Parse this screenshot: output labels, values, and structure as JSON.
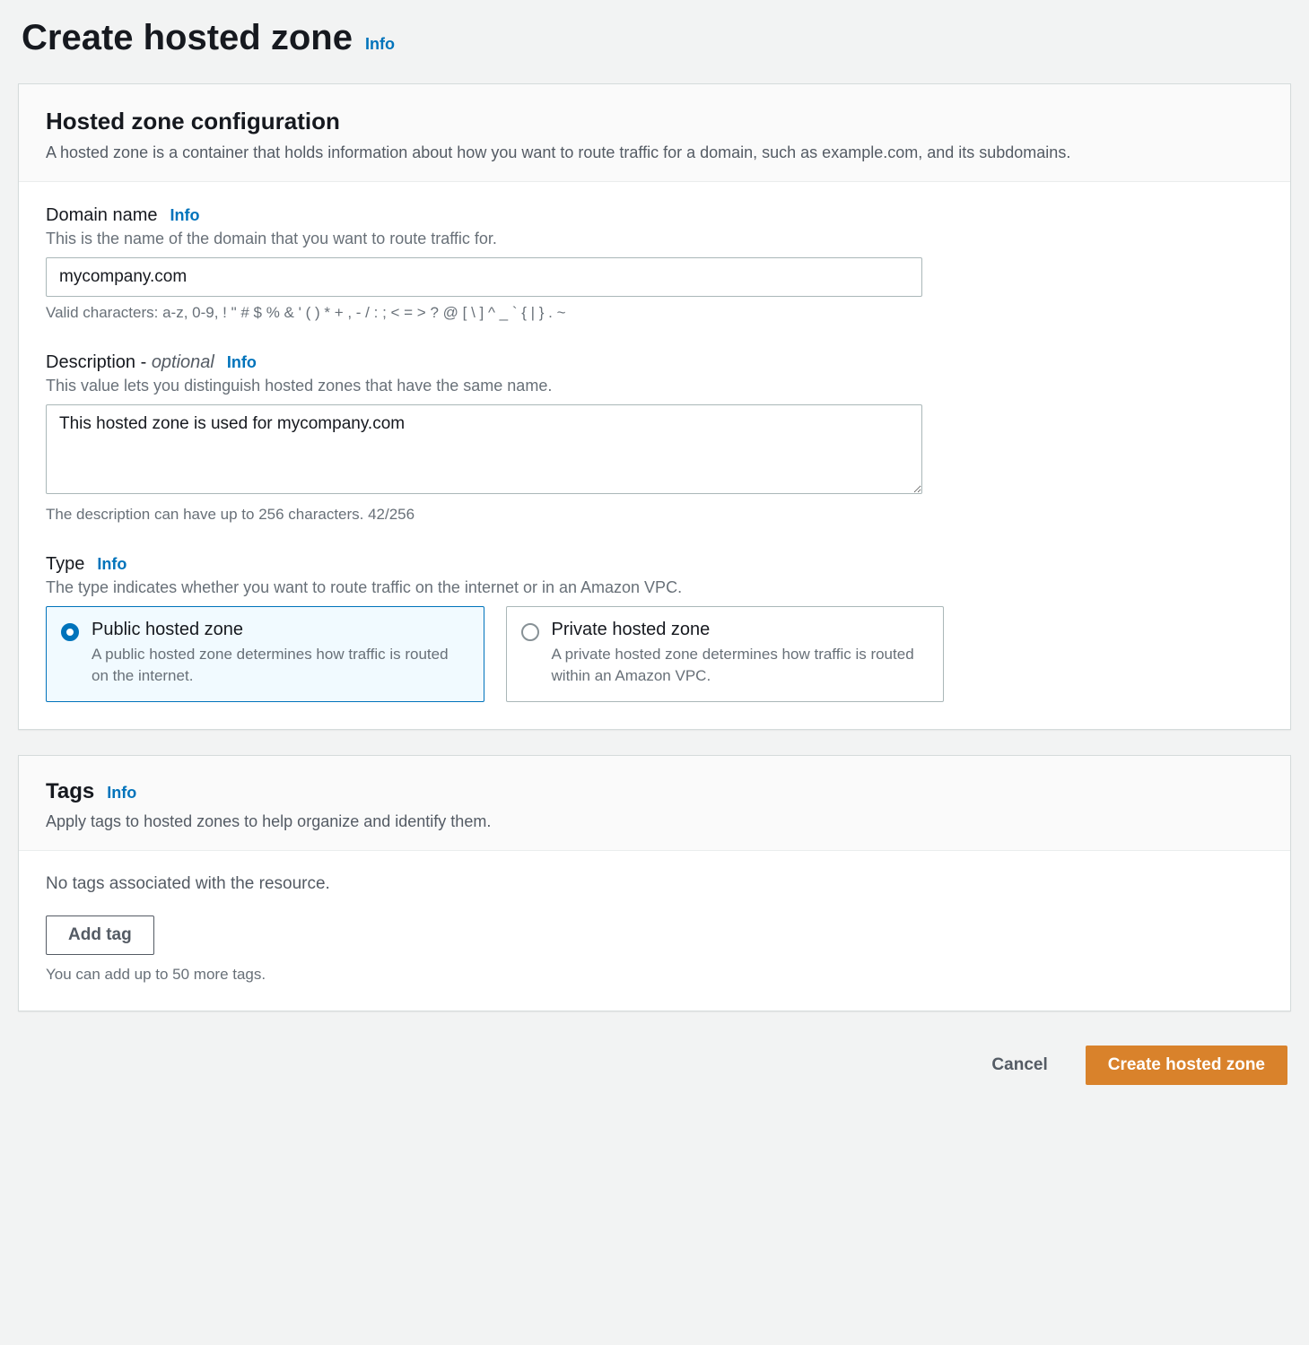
{
  "page": {
    "title": "Create hosted zone",
    "info": "Info"
  },
  "config_panel": {
    "title": "Hosted zone configuration",
    "subtitle": "A hosted zone is a container that holds information about how you want to route traffic for a domain, such as example.com, and its subdomains.",
    "domain": {
      "label": "Domain name",
      "info": "Info",
      "desc": "This is the name of the domain that you want to route traffic for.",
      "value": "mycompany.com",
      "hint": "Valid characters: a-z, 0-9, ! \" # $ % & ' ( ) * + , - / : ; < = > ? @ [ \\ ] ^ _ ` { | } . ~"
    },
    "description": {
      "label": "Description - ",
      "optional": "optional",
      "info": "Info",
      "desc": "This value lets you distinguish hosted zones that have the same name.",
      "value": "This hosted zone is used for mycompany.com",
      "hint": "The description can have up to 256 characters. 42/256"
    },
    "type": {
      "label": "Type",
      "info": "Info",
      "desc": "The type indicates whether you want to route traffic on the internet or in an Amazon VPC.",
      "options": [
        {
          "title": "Public hosted zone",
          "desc": "A public hosted zone determines how traffic is routed on the internet.",
          "selected": true
        },
        {
          "title": "Private hosted zone",
          "desc": "A private hosted zone determines how traffic is routed within an Amazon VPC.",
          "selected": false
        }
      ]
    }
  },
  "tags_panel": {
    "title": "Tags",
    "info": "Info",
    "subtitle": "Apply tags to hosted zones to help organize and identify them.",
    "empty_text": "No tags associated with the resource.",
    "add_button": "Add tag",
    "limit_hint": "You can add up to 50 more tags."
  },
  "footer": {
    "cancel": "Cancel",
    "create": "Create hosted zone"
  }
}
